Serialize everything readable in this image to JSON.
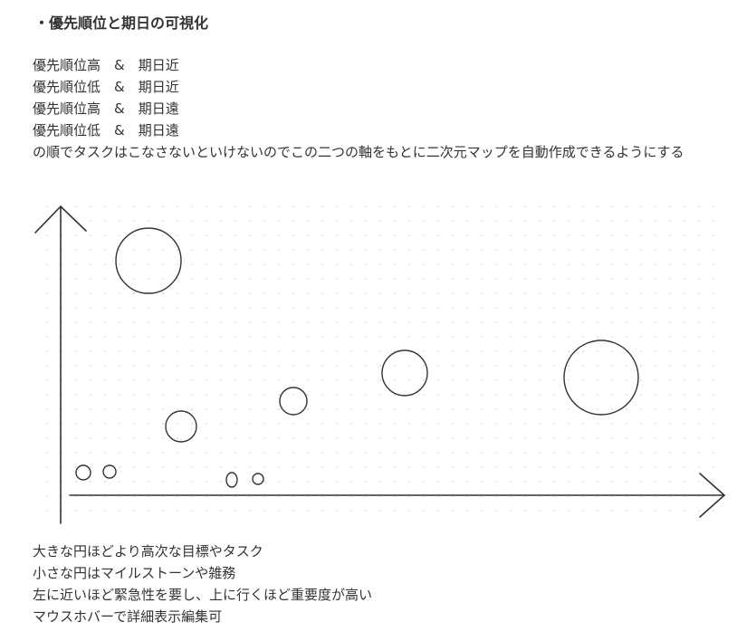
{
  "heading": "・優先順位と期日の可視化",
  "intro_lines": [
    "優先順位高　&　期日近",
    "優先順位低　&　期日近",
    "優先順位高　&　期日遠",
    "優先順位低　&　期日遠",
    "の順でタスクはこなさないといけないのでこの二つの軸をもとに二次元マップを自動作成できるようにする"
  ],
  "diagram": {
    "stroke_color": "#333333",
    "grid_dot_color": "#d4d4d4",
    "grid": true
  },
  "notes_lines": [
    "大きな円ほどより高次な目標やタスク",
    "小さな円はマイルストーンや雑務",
    "左に近いほど緊急性を要し、上に行くほど重要度が高い",
    "マウスホバーで詳細表示編集可"
  ]
}
